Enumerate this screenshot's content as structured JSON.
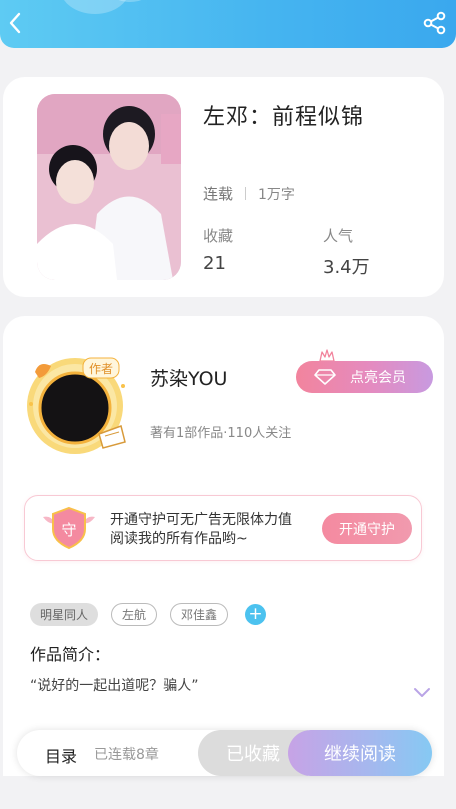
{
  "header": {
    "back_icon": "chevron-left-icon",
    "share_icon": "share-icon"
  },
  "book": {
    "title": "左邓：前程似锦",
    "status": "连载",
    "word_count": "1万字",
    "favorites_label": "收藏",
    "favorites_value": "21",
    "popularity_label": "人气",
    "popularity_value": "3.4万"
  },
  "author": {
    "badge": "作者",
    "name": "苏染YOU",
    "meta": "著有1部作品·110人关注",
    "vip_button": "点亮会员"
  },
  "guard": {
    "icon_text": "守",
    "text": "开通守护可无广告无限体力值阅读我的所有作品哟~",
    "button": "开通守护"
  },
  "tags": {
    "items": [
      "明星同人",
      "左航",
      "邓佳鑫"
    ],
    "add": "+"
  },
  "intro": {
    "title": "作品简介：",
    "text": "“说好的一起出道呢？骗人”"
  },
  "bottom": {
    "toc": "目录",
    "progress": "已连载8章",
    "collected": "已收藏",
    "continue": "继续阅读"
  },
  "colors": {
    "accent_blue": "#45b4f0",
    "vip_pink": "#f2849d",
    "continue_purple": "#c7a3e6"
  }
}
